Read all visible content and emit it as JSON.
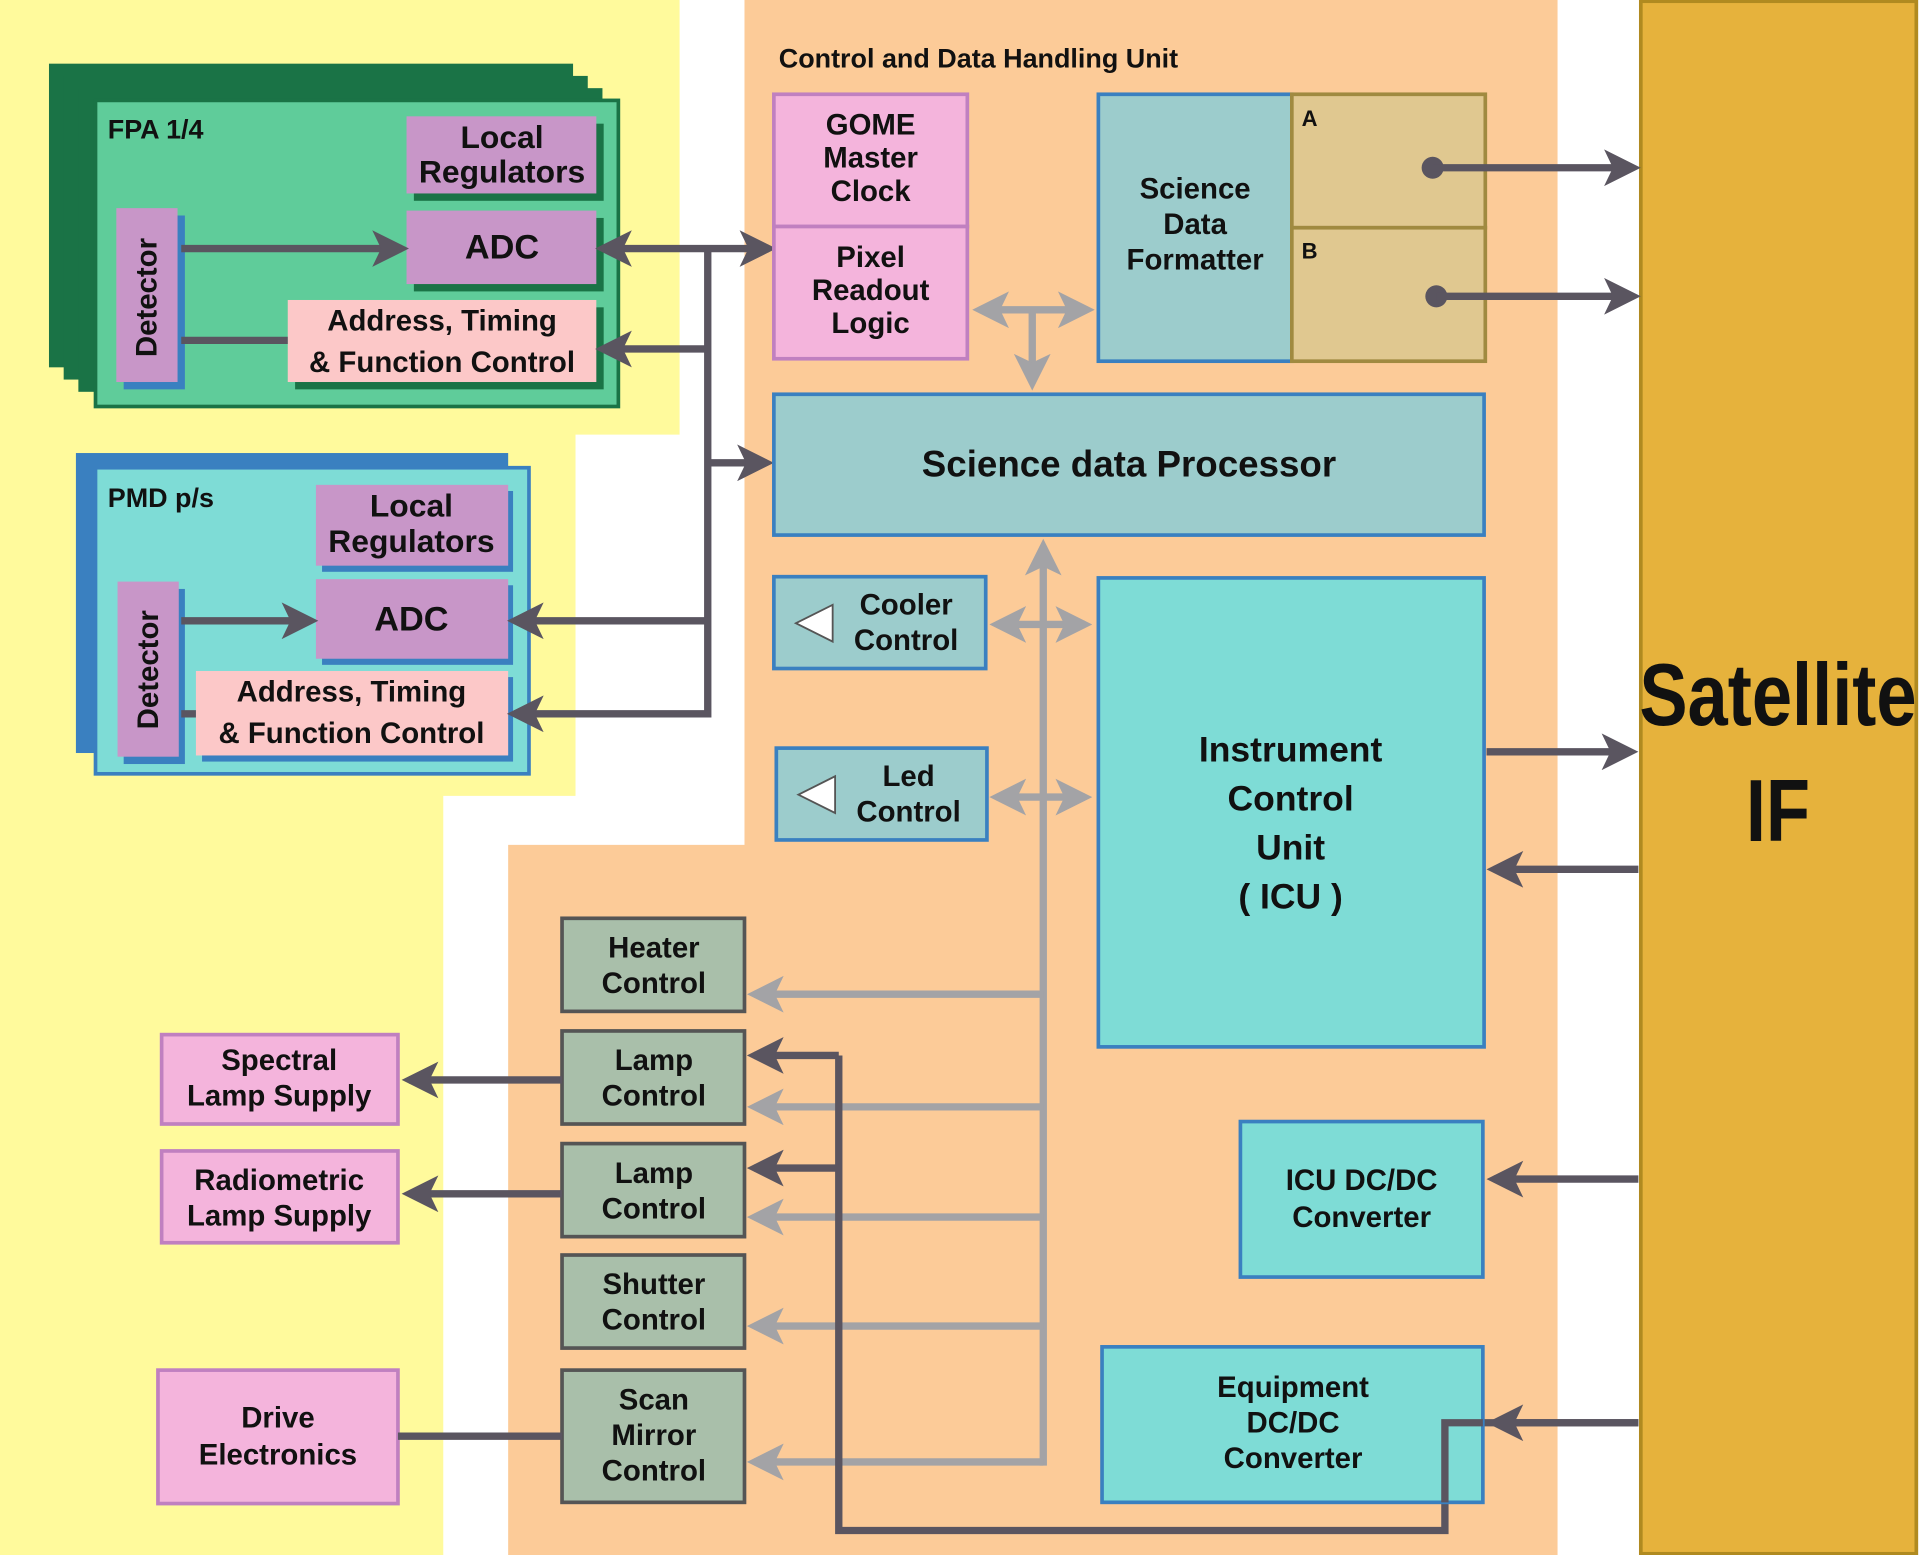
{
  "colors": {
    "yellow_region": "#fffa9c",
    "orange_region": "#fccb98",
    "satellite": "#e6b23c",
    "fpa_green": "#5fcc9a",
    "fpa_dark": "#1a7346",
    "pmd_cyan": "#7edcd6",
    "pmd_blue": "#3a80c0",
    "purple": "#c896c8",
    "pink": "#f4b4dc",
    "light_pink": "#fcc8c8",
    "teal": "#9ccccc",
    "gray_box": "#a9bfaa",
    "dark_arrow": "#5a5560",
    "gray_arrow": "#a3a3a6"
  },
  "fpa": {
    "title": "FPA 1/4",
    "local_regulators": [
      "Local",
      "Regulators"
    ],
    "adc": "ADC",
    "detector": "Detector",
    "address": [
      "Address, Timing",
      "&  Function Control"
    ]
  },
  "pmd": {
    "title": "PMD p/s",
    "local_regulators": [
      "Local",
      "Regulators"
    ],
    "adc": "ADC",
    "detector": "Detector",
    "address": [
      "Address, Timing",
      "&  Function Control"
    ]
  },
  "cdhu": {
    "title": "Control and Data Handling Unit",
    "master_clock": [
      "GOME",
      "Master",
      "Clock"
    ],
    "pixel_readout": [
      "Pixel",
      "Readout",
      "Logic"
    ],
    "formatter": [
      "Science",
      "Data",
      "Formatter"
    ],
    "channel_a": "A",
    "channel_b": "B",
    "processor": "Science data Processor",
    "cooler": [
      "Cooler",
      "Control"
    ],
    "led": [
      "Led",
      "Control"
    ],
    "icu": [
      "Instrument",
      "Control",
      "Unit",
      "( ICU )"
    ],
    "heater": [
      "Heater",
      "Control"
    ],
    "lamp1": [
      "Lamp",
      "Control"
    ],
    "lamp2": [
      "Lamp",
      "Control"
    ],
    "shutter": [
      "Shutter",
      "Control"
    ],
    "scan_mirror": [
      "Scan",
      "Mirror",
      "Control"
    ],
    "icu_dcdc": [
      "ICU DC/DC",
      "Converter"
    ],
    "equipment_dcdc": [
      "Equipment",
      "DC/DC",
      "Converter"
    ]
  },
  "external": {
    "spectral": [
      "Spectral",
      "Lamp Supply"
    ],
    "radiometric": [
      "Radiometric",
      "Lamp Supply"
    ],
    "drive": [
      "Drive",
      "Electronics"
    ]
  },
  "satellite": [
    "Satellite",
    "IF"
  ]
}
